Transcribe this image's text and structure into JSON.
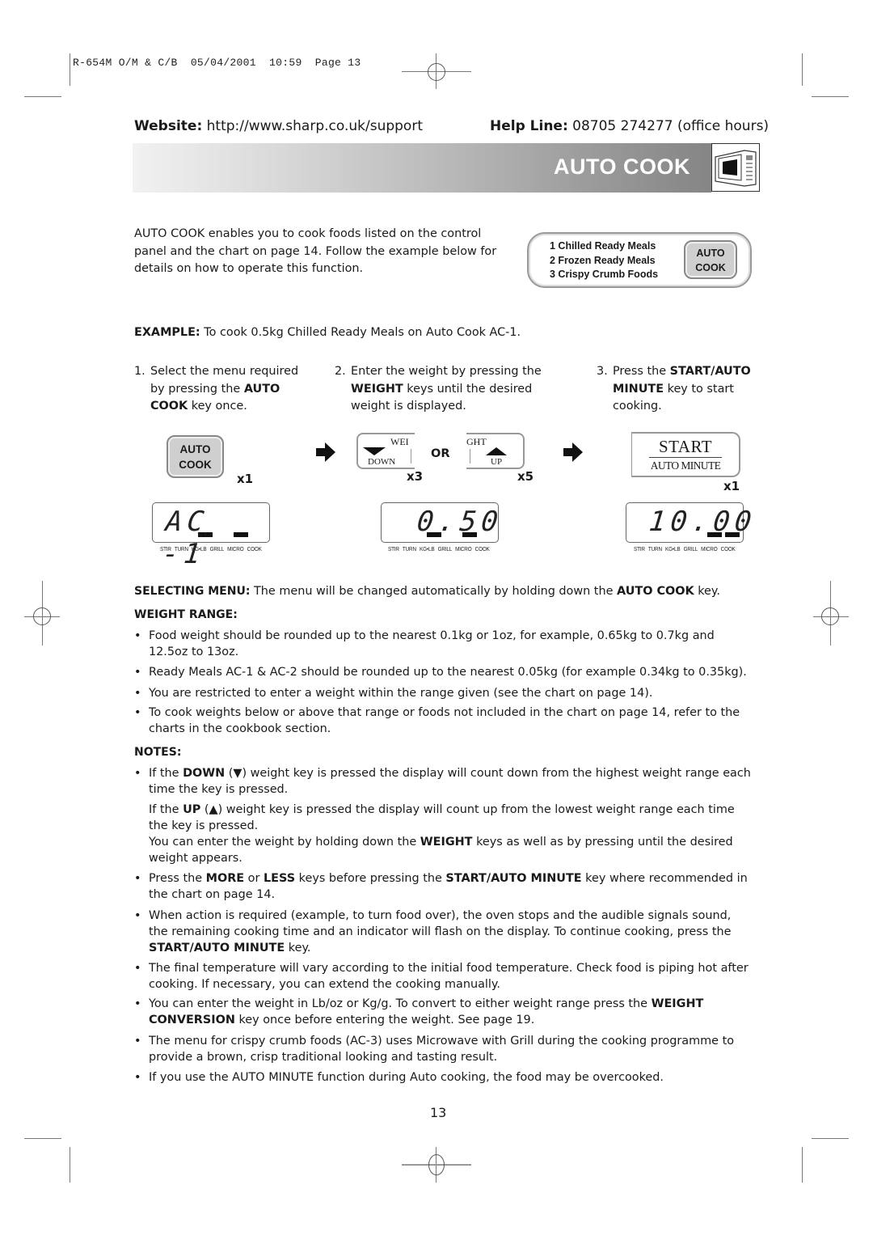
{
  "print_header": "R-654M O/M & C/B  05/04/2001  10:59  Page 13",
  "header": {
    "website_label": "Website:",
    "website_url": "http://www.sharp.co.uk/support",
    "helpline_label": "Help Line:",
    "helpline_value": "08705 274277 (office hours)"
  },
  "banner": {
    "title": "AUTO COOK",
    "icon": "microwave-icon"
  },
  "intro": "AUTO COOK enables you to cook foods listed on the control panel and the chart on page 14. Follow the example below for details on how to operate this function.",
  "control_panel": {
    "menu_items": [
      "1 Chilled Ready Meals",
      "2 Frozen Ready Meals",
      "3 Crispy Crumb Foods"
    ],
    "key_line1": "AUTO",
    "key_line2": "COOK"
  },
  "example": {
    "label": "EXAMPLE:",
    "text": " To cook 0.5kg Chilled Ready Meals on Auto Cook AC-1."
  },
  "steps": [
    {
      "num": "1.",
      "parts": [
        "Select the menu required",
        "by pressing the ",
        "AUTO",
        "COOK",
        " key once."
      ]
    },
    {
      "num": "2.",
      "parts": [
        "Enter the weight by pressing the",
        "WEIGHT",
        " keys until the desired",
        "weight is displayed."
      ]
    },
    {
      "num": "3.",
      "parts": [
        "Press the ",
        "START/AUTO",
        "MINUTE",
        " key to start",
        "cooking."
      ]
    }
  ],
  "keys": {
    "auto_cook": {
      "line1": "AUTO",
      "line2": "COOK",
      "presses": "x1"
    },
    "weight_down": {
      "top_label": "WEI",
      "bottom_label": "DOWN",
      "presses": "x3"
    },
    "or_label": "OR",
    "weight_up": {
      "top_label": "GHT",
      "bottom_label": "UP",
      "presses": "x5"
    },
    "start": {
      "line1": "START",
      "line2": "AUTO MINUTE",
      "presses": "x1"
    }
  },
  "displays": [
    {
      "readout": "AC -1",
      "labels": "STIR TURN KG•LB GRILL MICRO COOK"
    },
    {
      "readout": "0.50",
      "labels": "STIR TURN KG•LB GRILL MICRO COOK"
    },
    {
      "readout": "10.00",
      "labels": "STIR TURN KG•LB GRILL MICRO COOK"
    }
  ],
  "selecting_menu": {
    "label": "SELECTING MENU:",
    "text": " The menu will be changed automatically by holding down the ",
    "bold": "AUTO COOK",
    "tail": " key."
  },
  "weight_range": {
    "heading": "WEIGHT RANGE:",
    "bullets": [
      "Food weight should be rounded up to the nearest 0.1kg or 1oz, for example, 0.65kg to 0.7kg and 12.5oz to 13oz.",
      "Ready Meals AC-1 & AC-2 should be rounded up to the nearest 0.05kg (for example 0.34kg to 0.35kg).",
      "You are restricted to enter a weight within the range given (see the chart on page 14).",
      "To cook weights below or above that range or foods not included in the chart on page 14, refer to the charts in the cookbook section."
    ]
  },
  "notes": {
    "heading": "NOTES:",
    "n1": {
      "a": "If the ",
      "b": "DOWN",
      "c": " (▼) weight key is pressed the display will count down from the highest weight range each time the key is pressed."
    },
    "n1_sub1": {
      "a": "If the ",
      "b": "UP",
      "c": " (▲) weight key is pressed the display will count up from the lowest weight range each time the key is pressed."
    },
    "n1_sub2": {
      "a": "You can enter the weight by holding down the ",
      "b": "WEIGHT",
      "c": " keys as well as by pressing until the desired weight appears."
    },
    "n2": {
      "a": "Press the ",
      "b": "MORE",
      "c": " or ",
      "d": "LESS",
      "e": " keys before pressing the ",
      "f": "START/AUTO MINUTE",
      "g": " key where recommended in the chart on page 14."
    },
    "n3": {
      "a": "When action is required (example, to turn food over), the oven stops and the audible signals sound, the remaining cooking time and an indicator will flash on the display. To continue cooking, press the ",
      "b": "START/AUTO MINUTE",
      "c": " key."
    },
    "n4": "The final temperature will vary according to the initial food temperature. Check food is piping hot after cooking. If necessary, you can extend the cooking manually.",
    "n5": {
      "a": "You can enter the weight in Lb/oz or Kg/g. To convert to either weight range press the ",
      "b": "WEIGHT CONVERSION",
      "c": " key once before entering the weight. See page 19."
    },
    "n6": "The menu for crispy crumb foods (AC-3) uses Microwave with Grill during the cooking programme to provide a brown, crisp traditional looking and tasting result.",
    "n7": "If you use the AUTO MINUTE function during Auto cooking, the food may be overcooked."
  },
  "bullet_char": "•",
  "page_number": "13"
}
